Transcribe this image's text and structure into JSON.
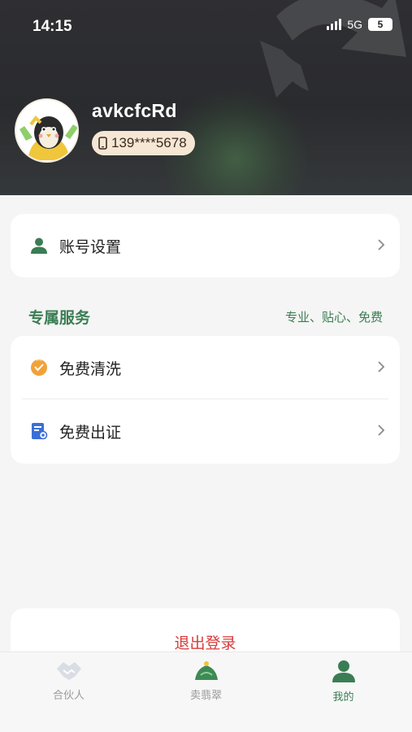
{
  "status_bar": {
    "time": "14:15",
    "network": "5G",
    "battery": "5"
  },
  "profile": {
    "username": "avkcfcRd",
    "phone": "139****5678"
  },
  "account_settings": {
    "label": "账号设置"
  },
  "services": {
    "title": "专属服务",
    "subtitle": "专业、贴心、免费",
    "items": [
      {
        "label": "免费清洗",
        "icon": "wash-icon",
        "color": "#f0a23a"
      },
      {
        "label": "免费出证",
        "icon": "certificate-icon",
        "color": "#3b6fd6"
      }
    ]
  },
  "logout": {
    "label": "退出登录"
  },
  "tabbar": {
    "items": [
      {
        "label": "合伙人",
        "icon": "handshake-icon",
        "active": false
      },
      {
        "label": "卖翡翠",
        "icon": "jade-icon",
        "active": false
      },
      {
        "label": "我的",
        "icon": "user-icon",
        "active": true
      }
    ]
  },
  "colors": {
    "accent": "#3a7d54",
    "danger": "#d93a3a",
    "header": "#2f2f33",
    "pill": "#f6e6d4"
  }
}
